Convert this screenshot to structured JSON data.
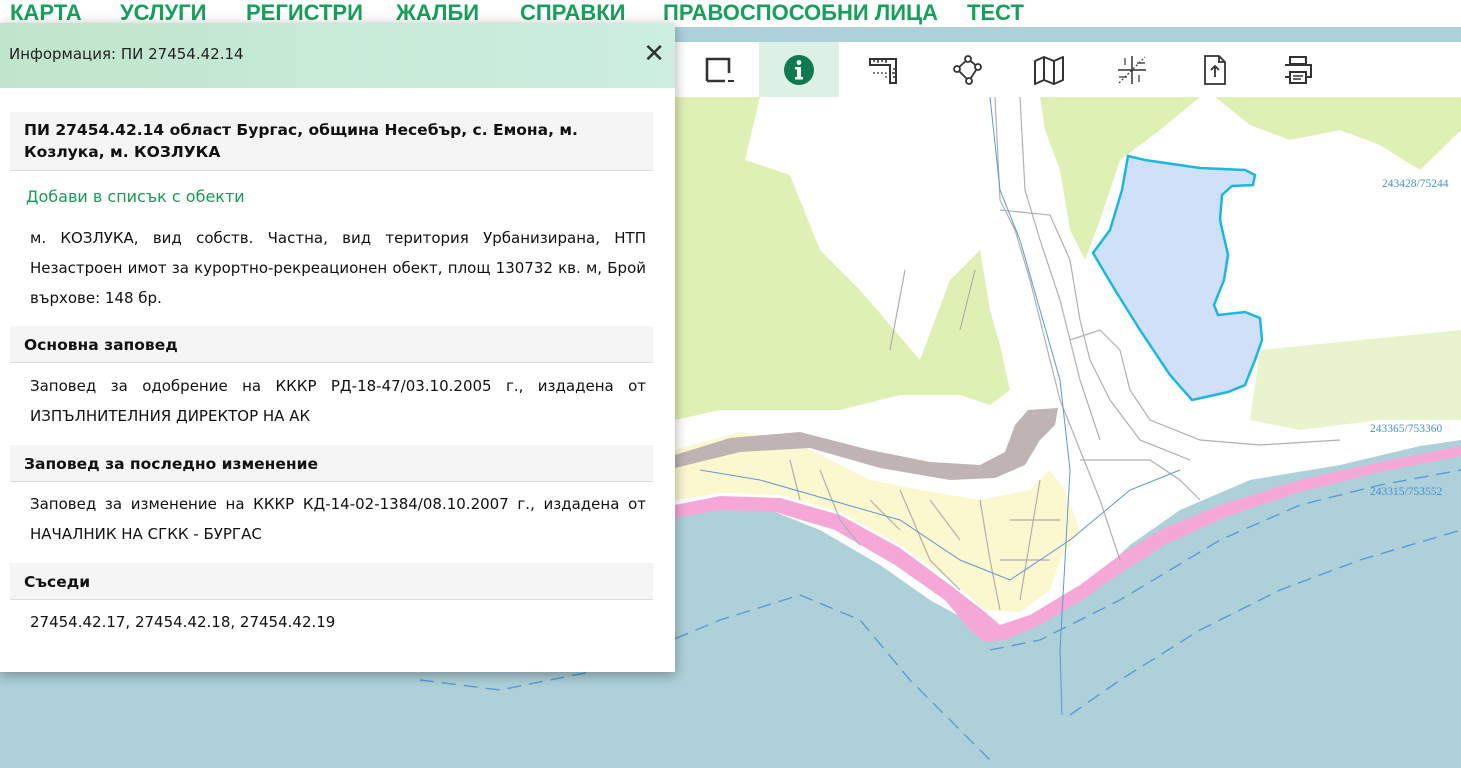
{
  "nav": {
    "items": [
      {
        "label": "КАРТА"
      },
      {
        "label": "УСЛУГИ"
      },
      {
        "label": "РЕГИСТРИ"
      },
      {
        "label": "ЖАЛБИ"
      },
      {
        "label": "СПРАВКИ"
      },
      {
        "label": "ПРАВОСПОСОБНИ ЛИЦА"
      },
      {
        "label": "ТЕСТ"
      }
    ]
  },
  "toolbar": {
    "tools": [
      {
        "icon": "select-rectangle-icon"
      },
      {
        "icon": "info-icon",
        "active": true
      },
      {
        "icon": "measure-ruler-icon"
      },
      {
        "icon": "polygon-area-icon"
      },
      {
        "icon": "map-layers-icon"
      },
      {
        "icon": "coordinates-crosshair-icon"
      },
      {
        "icon": "export-document-icon"
      },
      {
        "icon": "print-icon"
      }
    ]
  },
  "panel": {
    "title": "Информация: ПИ 27454.42.14",
    "close_glyph": "✕",
    "heading": "ПИ 27454.42.14 област Бургас, община Несебър, с. Емона, м. Козлука, м. КОЗЛУКА",
    "add_link": "Добави в списък с обекти",
    "description": "м. КОЗЛУКА, вид собств. Частна, вид територия Урбанизирана, НТП Незастроен имот за курортно-рекреационен обект, площ 130732 кв. м, Брой върхове: 148 бр.",
    "sections": [
      {
        "title": "Основна заповед",
        "text": "Заповед за одобрение на КККР РД-18-47/03.10.2005 г., издадена от ИЗПЪЛНИТЕЛНИЯ ДИРЕКТОР НА АК"
      },
      {
        "title": "Заповед за последно изменение",
        "text": "Заповед за изменение на КККР КД-14-02-1384/08.10.2007 г., издадена от НАЧАЛНИК НА СГКК - БУРГАС"
      },
      {
        "title": "Съседи",
        "text": "27454.42.17, 27454.42.18, 27454.42.19"
      }
    ]
  },
  "map": {
    "coord_labels": [
      "243428/75244",
      "243365/753360",
      "243315/753552"
    ],
    "colors": {
      "sea": "#aed1d9",
      "vegetation": "#dff0b4",
      "parcel_highlight": "#1ab8e0",
      "beach": "#f5a8d8",
      "road": "#bfb3b3"
    }
  }
}
